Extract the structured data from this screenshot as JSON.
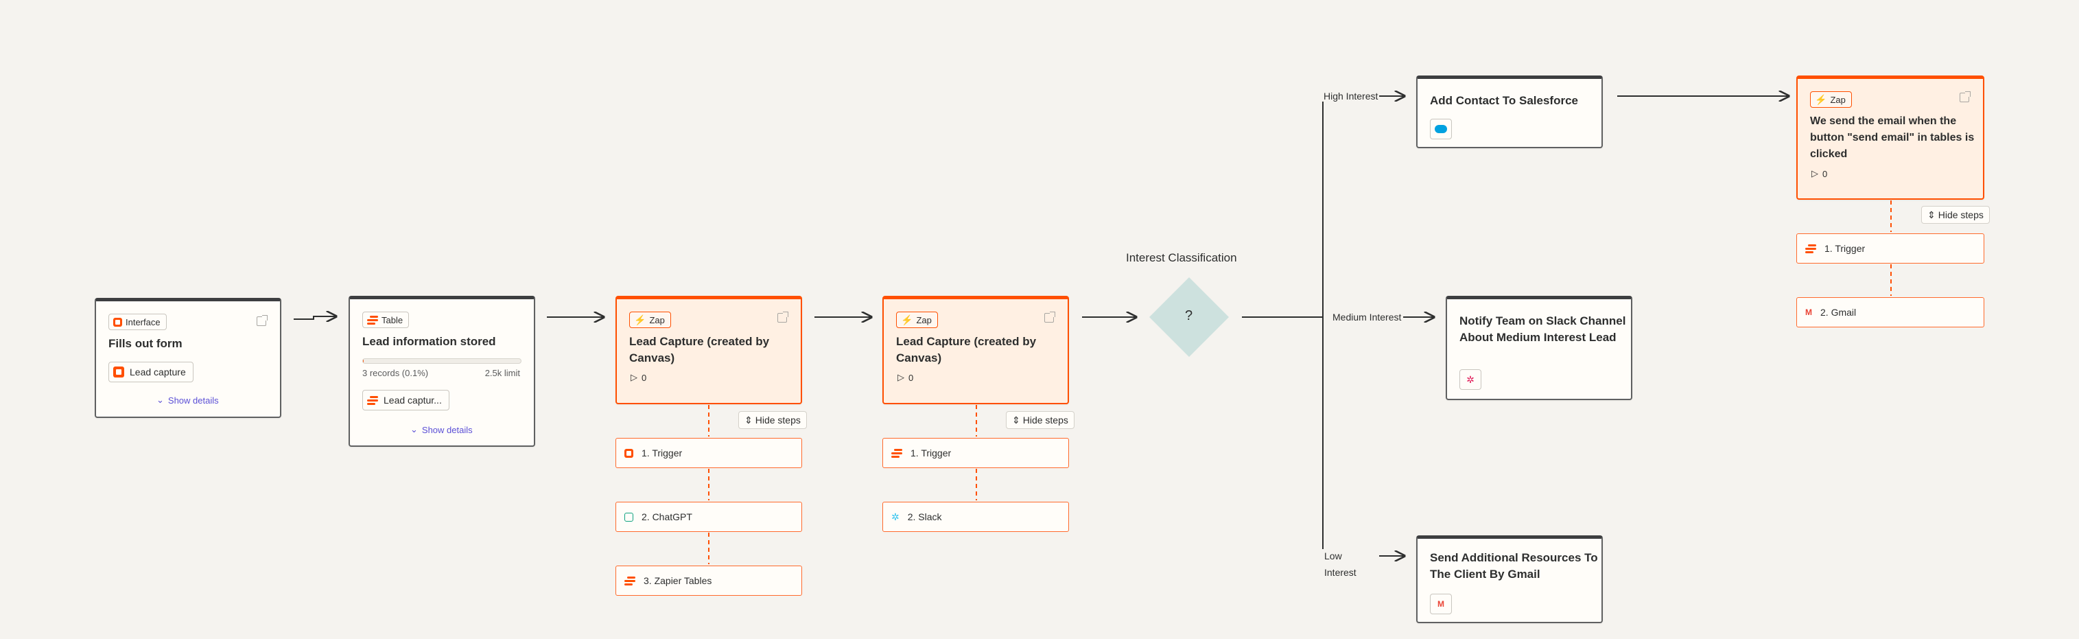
{
  "colors": {
    "accent": "#ff4f00",
    "canvas": "#f5f3ef",
    "decision": "#cde1de",
    "link": "#5b4fd6"
  },
  "nodes": {
    "form": {
      "badge": "Interface",
      "badge_icon": "interface-icon",
      "title": "Fills out form",
      "chip": "Lead capture",
      "show_details": "Show details"
    },
    "table": {
      "badge": "Table",
      "badge_icon": "table-icon",
      "title": "Lead information stored",
      "records": "3 records (0.1%)",
      "limit": "2.5k limit",
      "usage_fraction": 0.001,
      "chip": "Lead captur...",
      "show_details": "Show details"
    },
    "zap1": {
      "badge": "Zap",
      "title": "Lead Capture (created by Canvas)",
      "runs": "0",
      "hide_steps": "Hide steps",
      "steps": [
        "1. Trigger",
        "2. ChatGPT",
        "3. Zapier Tables"
      ]
    },
    "zap2": {
      "badge": "Zap",
      "title": "Lead Capture (created by Canvas)",
      "runs": "0",
      "hide_steps": "Hide steps",
      "steps": [
        "1. Trigger",
        "2. Slack"
      ]
    },
    "decision": {
      "title": "Interest Classification",
      "symbol": "?"
    },
    "branches": {
      "high": "High Interest",
      "medium": "Medium Interest",
      "low_line1": "Low",
      "low_line2": "Interest"
    },
    "salesforce": {
      "title": "Add Contact To Salesforce",
      "icon": "salesforce-icon"
    },
    "slack_notify": {
      "title_line1": "Notify Team on Slack Channel",
      "title_line2": "About Medium Interest Lead",
      "icon": "slack-icon"
    },
    "gmail_send": {
      "title_line1": "Send Additional Resources To",
      "title_line2": "The Client By Gmail",
      "icon": "gmail-icon"
    },
    "zap3": {
      "badge": "Zap",
      "title_line1": "We send the email when the",
      "title_line2": "button \"send email\" in tables is",
      "title_line3": "clicked",
      "runs": "0",
      "hide_steps": "Hide steps",
      "steps": [
        "1. Trigger",
        "2. Gmail"
      ]
    }
  }
}
